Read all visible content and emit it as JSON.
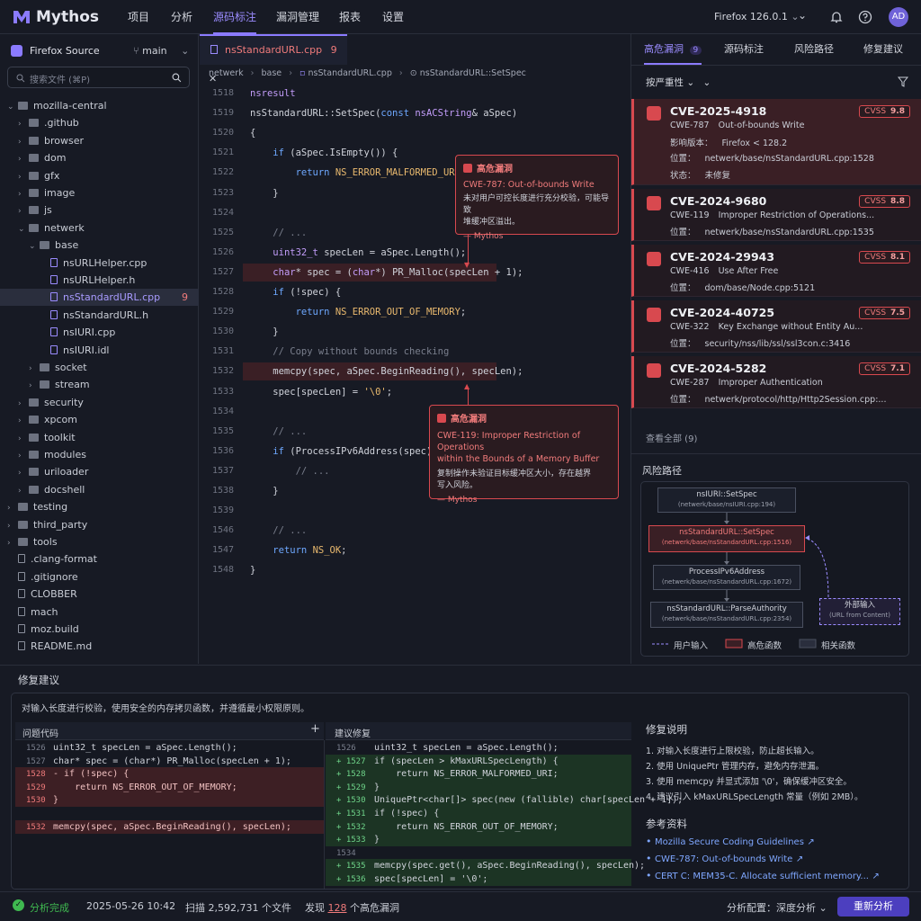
{
  "app": {
    "name": "Mythos"
  },
  "nav": {
    "items": [
      "项目",
      "分析",
      "源码标注",
      "漏洞管理",
      "报表",
      "设置"
    ],
    "active": "源码标注",
    "browser": "Firefox 126.0.1",
    "avatar": "AD"
  },
  "sidebar": {
    "source": "Firefox Source",
    "branch": "main",
    "search_placeholder": "搜索文件 (⌘P)",
    "tree": [
      {
        "label": "mozilla-central",
        "depth": 0,
        "type": "folder",
        "open": true
      },
      {
        "label": ".github",
        "depth": 1,
        "type": "folder"
      },
      {
        "label": "browser",
        "depth": 1,
        "type": "folder"
      },
      {
        "label": "dom",
        "depth": 1,
        "type": "folder"
      },
      {
        "label": "gfx",
        "depth": 1,
        "type": "folder"
      },
      {
        "label": "image",
        "depth": 1,
        "type": "folder"
      },
      {
        "label": "js",
        "depth": 1,
        "type": "folder"
      },
      {
        "label": "netwerk",
        "depth": 1,
        "type": "folder",
        "open": true
      },
      {
        "label": "base",
        "depth": 2,
        "type": "folder",
        "open": true
      },
      {
        "label": "nsURLHelper.cpp",
        "depth": 3,
        "type": "file"
      },
      {
        "label": "nsURLHelper.h",
        "depth": 3,
        "type": "file"
      },
      {
        "label": "nsStandardURL.cpp",
        "depth": 3,
        "type": "file",
        "selected": true,
        "badge": "9"
      },
      {
        "label": "nsStandardURL.h",
        "depth": 3,
        "type": "file"
      },
      {
        "label": "nsIURI.cpp",
        "depth": 3,
        "type": "file"
      },
      {
        "label": "nsIURI.idl",
        "depth": 3,
        "type": "file"
      },
      {
        "label": "socket",
        "depth": 2,
        "type": "folder"
      },
      {
        "label": "stream",
        "depth": 2,
        "type": "folder"
      },
      {
        "label": "security",
        "depth": 1,
        "type": "folder"
      },
      {
        "label": "xpcom",
        "depth": 1,
        "type": "folder"
      },
      {
        "label": "toolkit",
        "depth": 1,
        "type": "folder"
      },
      {
        "label": "modules",
        "depth": 1,
        "type": "folder"
      },
      {
        "label": "uriloader",
        "depth": 1,
        "type": "folder"
      },
      {
        "label": "docshell",
        "depth": 1,
        "type": "folder"
      },
      {
        "label": "testing",
        "depth": 0,
        "type": "folder"
      },
      {
        "label": "third_party",
        "depth": 0,
        "type": "folder"
      },
      {
        "label": "tools",
        "depth": 0,
        "type": "folder"
      },
      {
        "label": ".clang-format",
        "depth": 0,
        "type": "file"
      },
      {
        "label": ".gitignore",
        "depth": 0,
        "type": "file"
      },
      {
        "label": "CLOBBER",
        "depth": 0,
        "type": "file"
      },
      {
        "label": "mach",
        "depth": 0,
        "type": "file"
      },
      {
        "label": "moz.build",
        "depth": 0,
        "type": "file"
      },
      {
        "label": "README.md",
        "depth": 0,
        "type": "file"
      }
    ]
  },
  "editor": {
    "tab_label": "nsStandardURL.cpp",
    "tab_badge": "9",
    "breadcrumb": [
      "netwerk",
      "base",
      "nsStandardURL.cpp",
      "nsStandardURL::SetSpec"
    ],
    "lines": [
      {
        "n": "1518",
        "code": "nsresult"
      },
      {
        "n": "1519",
        "code": "nsStandardURL::SetSpec(const nsACString& aSpec)"
      },
      {
        "n": "1520",
        "code": "{"
      },
      {
        "n": "1521",
        "code": "    if (aSpec.IsEmpty()) {"
      },
      {
        "n": "1522",
        "code": "        return NS_ERROR_MALFORMED_URI;"
      },
      {
        "n": "1523",
        "code": "    }"
      },
      {
        "n": "1524",
        "code": ""
      },
      {
        "n": "1525",
        "code": "    // ..."
      },
      {
        "n": "1526",
        "code": "    uint32_t specLen = aSpec.Length();"
      },
      {
        "n": "1527",
        "code": "    char* spec = (char*) PR_Malloc(specLen + 1);",
        "hl": true
      },
      {
        "n": "1528",
        "code": "    if (!spec) {"
      },
      {
        "n": "1529",
        "code": "        return NS_ERROR_OUT_OF_MEMORY;"
      },
      {
        "n": "1530",
        "code": "    }"
      },
      {
        "n": "1531",
        "code": "    // Copy without bounds checking"
      },
      {
        "n": "1532",
        "code": "    memcpy(spec, aSpec.BeginReading(), specLen);",
        "hl": true
      },
      {
        "n": "1533",
        "code": "    spec[specLen] = '\\0';"
      },
      {
        "n": "1534",
        "code": ""
      },
      {
        "n": "1535",
        "code": "    // ..."
      },
      {
        "n": "1536",
        "code": "    if (ProcessIPv6Address(spec)) {"
      },
      {
        "n": "1537",
        "code": "        // ..."
      },
      {
        "n": "1538",
        "code": "    }"
      },
      {
        "n": "1539",
        "code": ""
      },
      {
        "n": "1546",
        "code": "    // ..."
      },
      {
        "n": "1547",
        "code": "    return NS_OK;"
      },
      {
        "n": "1548",
        "code": "}"
      }
    ],
    "annotations": [
      {
        "title": "高危漏洞",
        "cwe": "CWE-787: Out-of-bounds Write",
        "desc1": "未对用户可控长度进行充分校验，可能导致",
        "desc2": "堆缓冲区溢出。",
        "author": "— Mythos"
      },
      {
        "title": "高危漏洞",
        "cwe": "CWE-119: Improper Restriction of Operations",
        "cwe2": "within the Bounds of a Memory Buffer",
        "desc1": "复制操作未验证目标缓冲区大小，存在越界",
        "desc2": "写入风险。",
        "author": "— Mythos"
      }
    ]
  },
  "right_panel": {
    "tabs": [
      "高危漏洞",
      "源码标注",
      "风险路径",
      "修复建议"
    ],
    "tab_badge": "9",
    "sort_label": "按严重性",
    "cves": [
      {
        "id": "CVE-2025-4918",
        "cvss_label": "CVSS",
        "cvss": "9.8",
        "cwe": "CWE-787",
        "title": "Out-of-bounds Write",
        "version_label": "影响版本：",
        "version": "Firefox  <  128.2",
        "loc_label": "位置：",
        "loc": "netwerk/base/nsStandardURL.cpp:1528",
        "status_label": "状态：",
        "status": "未修复"
      },
      {
        "id": "CVE-2024-9680",
        "cvss_label": "CVSS",
        "cvss": "8.8",
        "cwe": "CWE-119",
        "title": "Improper Restriction of Operations...",
        "loc_label": "位置：",
        "loc": "netwerk/base/nsStandardURL.cpp:1535"
      },
      {
        "id": "CVE-2024-29943",
        "cvss_label": "CVSS",
        "cvss": "8.1",
        "cwe": "CWE-416",
        "title": "Use After Free",
        "loc_label": "位置：",
        "loc": "dom/base/Node.cpp:5121"
      },
      {
        "id": "CVE-2024-40725",
        "cvss_label": "CVSS",
        "cvss": "7.5",
        "cwe": "CWE-322",
        "title": "Key Exchange without Entity Au...",
        "loc_label": "位置：",
        "loc": "security/nss/lib/ssl/ssl3con.c:3416"
      },
      {
        "id": "CVE-2024-5282",
        "cvss_label": "CVSS",
        "cvss": "7.1",
        "cwe": "CWE-287",
        "title": "Improper Authentication",
        "loc_label": "位置：",
        "loc": "netwerk/protocol/http/Http2Session.cpp:..."
      }
    ],
    "view_all": "查看全部 (9)",
    "risk_title": "风险路径",
    "graph": {
      "nodes": [
        {
          "name": "nsIURI::SetSpec",
          "path": "(netwerk/base/nsIURI.cpp:194)"
        },
        {
          "name": "nsStandardURL::SetSpec",
          "path": "(netwerk/base/nsStandardURL.cpp:1516)",
          "red": true
        },
        {
          "name": "ProcessIPv6Address",
          "path": "(netwerk/base/nsStandardURL.cpp:1672)"
        },
        {
          "name": "nsStandardURL::ParseAuthority",
          "path": "(netwerk/base/nsStandardURL.cpp:2354)"
        }
      ],
      "external": {
        "name": "外部输入",
        "sub": "(URL from Content)"
      },
      "legend": [
        "用户输入",
        "高危函数",
        "相关函数"
      ]
    }
  },
  "fix": {
    "title": "修复建议",
    "summary": "对输入长度进行校验，使用安全的内存拷贝函数，并遵循最小权限原则。",
    "problem_title": "问题代码",
    "suggest_title": "建议修复",
    "problem": [
      {
        "n": "1526",
        "code": "uint32_t specLen = aSpec.Length();",
        "k": "ctx"
      },
      {
        "n": "1527",
        "code": "char* spec = (char*) PR_Malloc(specLen + 1);",
        "k": "ctx"
      },
      {
        "n": "1528",
        "code": "- if (!spec) {",
        "k": "del"
      },
      {
        "n": "1529",
        "code": "    return NS_ERROR_OUT_OF_MEMORY;",
        "k": "del"
      },
      {
        "n": "1530",
        "code": "}",
        "k": "del"
      },
      {
        "n": "",
        "code": "",
        "k": "blank"
      },
      {
        "n": "1532",
        "code": "memcpy(spec, aSpec.BeginReading(), specLen);",
        "k": "del"
      }
    ],
    "suggest": [
      {
        "n": "1526",
        "code": "uint32_t specLen = aSpec.Length();",
        "k": "ctx"
      },
      {
        "n": "+ 1527",
        "code": "if (specLen > kMaxURLSpecLength) {",
        "k": "add"
      },
      {
        "n": "+ 1528",
        "code": "    return NS_ERROR_MALFORMED_URI;",
        "k": "add"
      },
      {
        "n": "+ 1529",
        "code": "}",
        "k": "add"
      },
      {
        "n": "+ 1530",
        "code": "UniquePtr<char[]> spec(new (fallible) char[specLen + 1]);",
        "k": "add"
      },
      {
        "n": "+ 1531",
        "code": "if (!spec) {",
        "k": "add"
      },
      {
        "n": "+ 1532",
        "code": "    return NS_ERROR_OUT_OF_MEMORY;",
        "k": "add"
      },
      {
        "n": "+ 1533",
        "code": "}",
        "k": "add"
      },
      {
        "n": "1534",
        "code": "",
        "k": "ctx"
      },
      {
        "n": "+ 1535",
        "code": "memcpy(spec.get(), aSpec.BeginReading(), specLen);",
        "k": "add"
      },
      {
        "n": "+ 1536",
        "code": "spec[specLen] = '\\0';",
        "k": "add"
      }
    ],
    "notes_title": "修复说明",
    "notes": [
      "1.  对输入长度进行上限校验，防止超长输入。",
      "2.  使用  UniquePtr  管理内存，避免内存泄漏。",
      "3.  使用  memcpy  并显式添加  '\\0'，确保缓冲区安全。",
      "4.  建议引入  kMaxURLSpecLength  常量（例如 2MB）。"
    ],
    "refs_title": "参考资料",
    "refs": [
      "Mozilla Secure Coding Guidelines",
      "CWE-787: Out-of-bounds Write",
      "CERT C: MEM35-C. Allocate sufficient memory..."
    ]
  },
  "status": {
    "done": "分析完成",
    "time": "2025-05-26 10:42",
    "scan": "扫描 2,592,731 个文件",
    "found_pre": "发现",
    "found_count": "128",
    "found_post": "个高危漏洞",
    "config": "分析配置：深度分析",
    "reanalyze": "重新分析"
  },
  "colors": {
    "accent": "#8b7bff",
    "danger": "#d8494f",
    "success": "#3fb950",
    "bg": "#171a24"
  }
}
